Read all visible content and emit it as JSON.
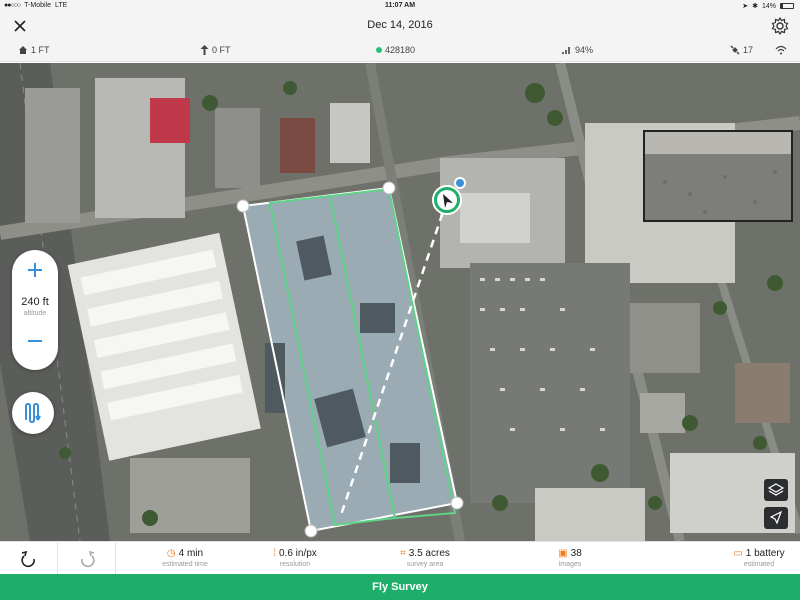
{
  "status_bar": {
    "carrier": "T-Mobile",
    "network": "LTE",
    "time": "11:07 AM",
    "battery_pct": "14%"
  },
  "header": {
    "date": "Dec 14, 2016"
  },
  "info_bar": {
    "home_alt": "1 FT",
    "alt": "0 FT",
    "aircraft_id": "428180",
    "signal": "94%",
    "satellites": "17"
  },
  "altitude_control": {
    "value": "240 ft",
    "label": "altitude"
  },
  "stats": {
    "time": {
      "value": "4 min",
      "label": "estimated time"
    },
    "resolution": {
      "value": "0.6 in/px",
      "label": "resolution"
    },
    "area": {
      "value": "3.5 acres",
      "label": "survey area"
    },
    "images": {
      "value": "38",
      "label": "images"
    },
    "battery": {
      "value": "1 battery",
      "label": "estimated"
    }
  },
  "actions": {
    "fly_label": "Fly Survey"
  },
  "colors": {
    "accent_green": "#1fae6a",
    "accent_blue": "#3a8fd9",
    "stat_icon_orange": "#f07a1a"
  },
  "icons": {
    "close": "close-icon",
    "settings": "gear-icon",
    "home": "home-icon",
    "altitude": "up-arrow-icon",
    "signal": "signal-icon",
    "satellite": "satellite-icon",
    "wifi": "wifi-icon",
    "undo": "undo-icon",
    "redo": "redo-icon",
    "layers": "layers-icon",
    "locate": "locate-icon"
  }
}
